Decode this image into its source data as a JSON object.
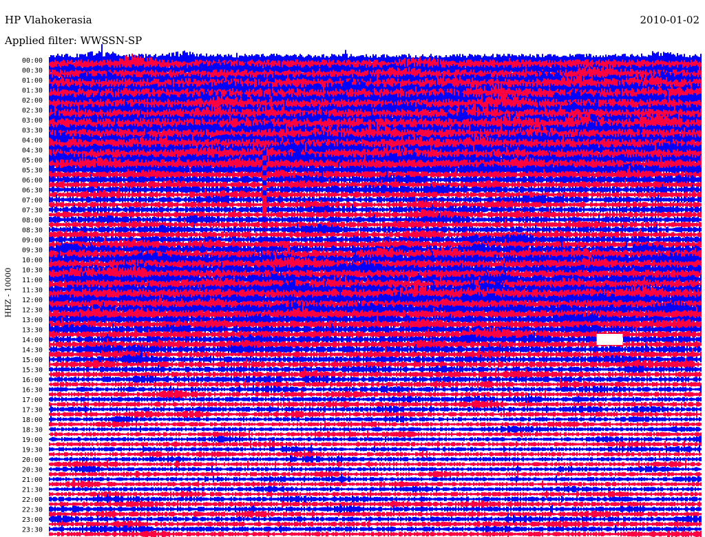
{
  "header": {
    "station": "HP Vlahokerasia",
    "date": "2010-01-02",
    "filter": "Applied filter: WWSSN-SP"
  },
  "channel_label": "HHZ - 10000",
  "colors": {
    "trace_a": "#0000ff",
    "trace_b": "#ff0040",
    "background": "#ffffff"
  },
  "chart_data": {
    "type": "line",
    "subtype": "helicorder",
    "title": "HP Vlahokerasia",
    "date": "2010-01-02",
    "ylabel": "HHZ - 10000",
    "row_interval_minutes": 15,
    "color_cycle": [
      "#0000ff",
      "#ff0040"
    ],
    "tick_labels": [
      "00:00",
      "00:30",
      "01:00",
      "01:30",
      "02:00",
      "02:30",
      "03:00",
      "03:30",
      "04:00",
      "04:30",
      "05:00",
      "05:30",
      "06:00",
      "06:30",
      "07:00",
      "07:30",
      "08:00",
      "08:30",
      "09:00",
      "09:30",
      "10:00",
      "10:30",
      "11:00",
      "11:30",
      "12:00",
      "12:30",
      "13:00",
      "13:30",
      "14:00",
      "14:30",
      "15:00",
      "15:30",
      "16:00",
      "16:30",
      "17:00",
      "17:30",
      "18:00",
      "18:30",
      "19:00",
      "19:30",
      "20:00",
      "20:30",
      "21:00",
      "21:30",
      "22:00",
      "22:30",
      "23:00",
      "23:30"
    ],
    "relative_amplitude_per_row": [
      1.0,
      0.9,
      0.95,
      0.9,
      1.0,
      1.1,
      1.1,
      1.1,
      1.1,
      1.0,
      1.0,
      1.0,
      1.0,
      1.1,
      1.0,
      1.0,
      1.0,
      1.0,
      1.0,
      0.95,
      0.95,
      0.9,
      0.75,
      0.6,
      0.6,
      0.55,
      0.55,
      0.5,
      0.5,
      0.5,
      0.5,
      0.5,
      0.5,
      0.5,
      0.5,
      0.5,
      0.55,
      0.6,
      0.7,
      0.8,
      0.85,
      0.8,
      0.8,
      0.8,
      0.8,
      0.8,
      0.85,
      0.95,
      0.85,
      0.75,
      0.85,
      0.75,
      0.65,
      0.65,
      0.6,
      0.6,
      0.55,
      0.55,
      0.55,
      0.5,
      0.5,
      0.5,
      0.45,
      0.45,
      0.45,
      0.4,
      0.4,
      0.4,
      0.4,
      0.4,
      0.4,
      0.4,
      0.35,
      0.35,
      0.35,
      0.35,
      0.35,
      0.35,
      0.35,
      0.35,
      0.35,
      0.35,
      0.35,
      0.35,
      0.35,
      0.35,
      0.35,
      0.35,
      0.4,
      0.4,
      0.4,
      0.4,
      0.4,
      0.4,
      0.4,
      0.4
    ],
    "annotations": [
      {
        "type": "spike",
        "row_start": 22,
        "row_end": 31,
        "x_fraction": 0.33
      },
      {
        "type": "data_gap",
        "row": 56,
        "x_fraction_start": 0.84,
        "x_fraction_end": 0.88
      }
    ]
  }
}
